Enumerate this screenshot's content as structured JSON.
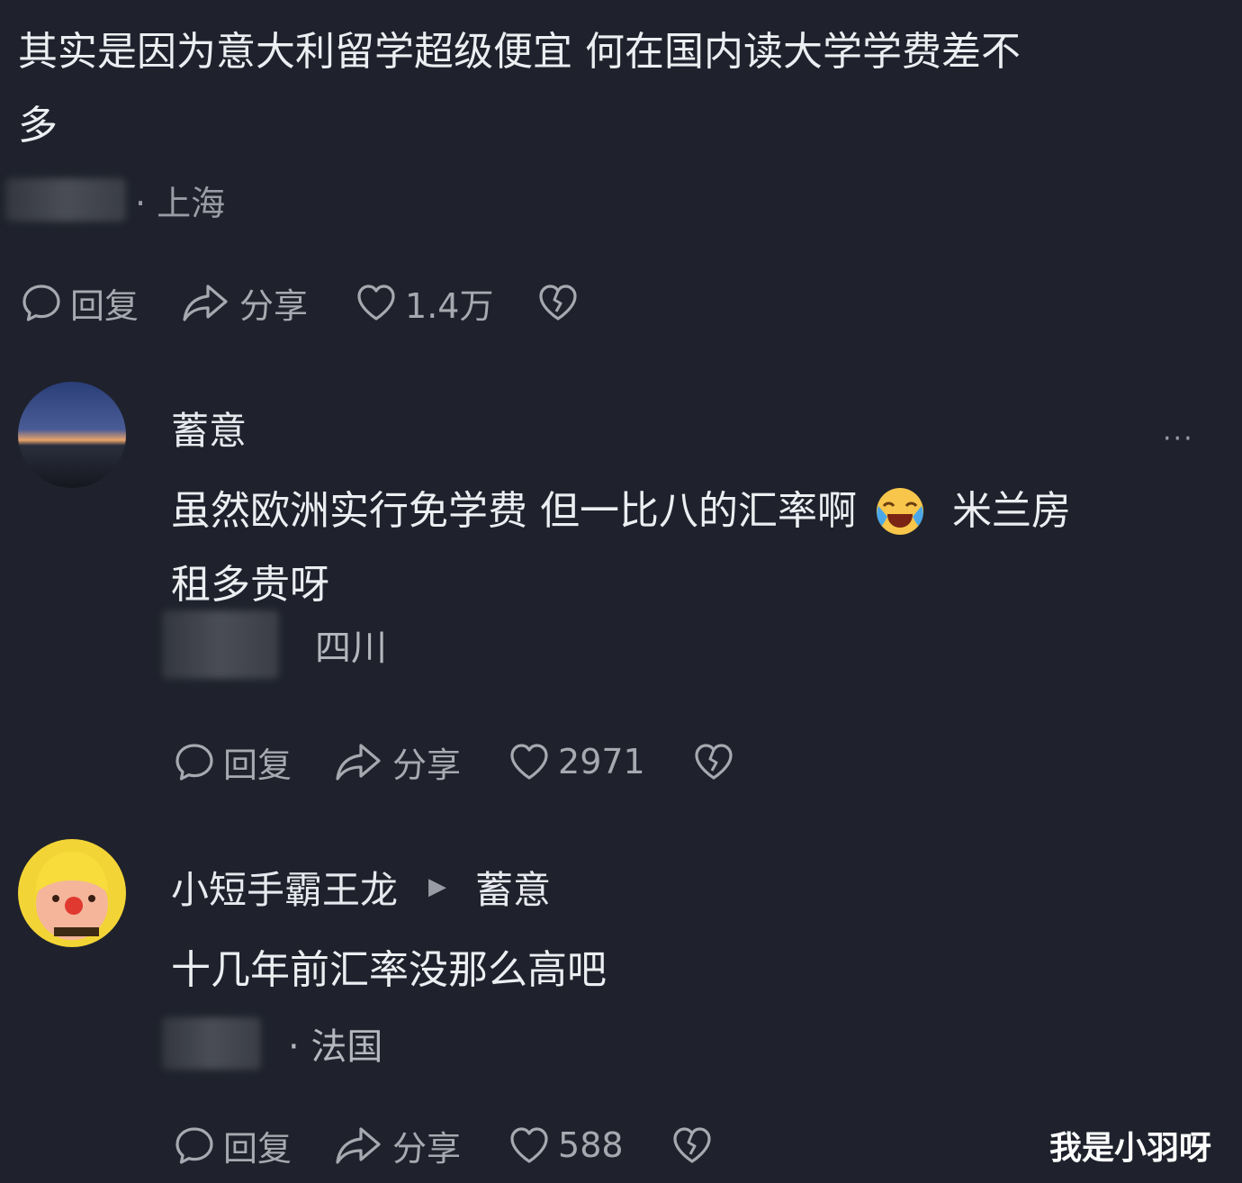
{
  "comment1": {
    "text_line1": "其实是因为意大利留学超级便宜 何在国内读大学学费差不",
    "text_line2": "多",
    "location": "· 上海",
    "reply_label": "回复",
    "share_label": "分享",
    "likes": "1.4万"
  },
  "comment2": {
    "username": "蓄意",
    "more": "···",
    "text_line1_a": "虽然欧洲实行免学费 但一比八的汇率啊",
    "text_line1_b": "米兰房",
    "text_line2": "租多贵呀",
    "emoji": "crying-laughing-emoji",
    "location": "四川",
    "reply_label": "回复",
    "share_label": "分享",
    "likes": "2971"
  },
  "comment3": {
    "username": "小短手霸王龙",
    "reply_to": "蓄意",
    "text": "十几年前汇率没那么高吧",
    "location": "· 法国",
    "reply_label": "回复",
    "share_label": "分享",
    "likes": "588"
  },
  "watermark": "我是小羽呀"
}
